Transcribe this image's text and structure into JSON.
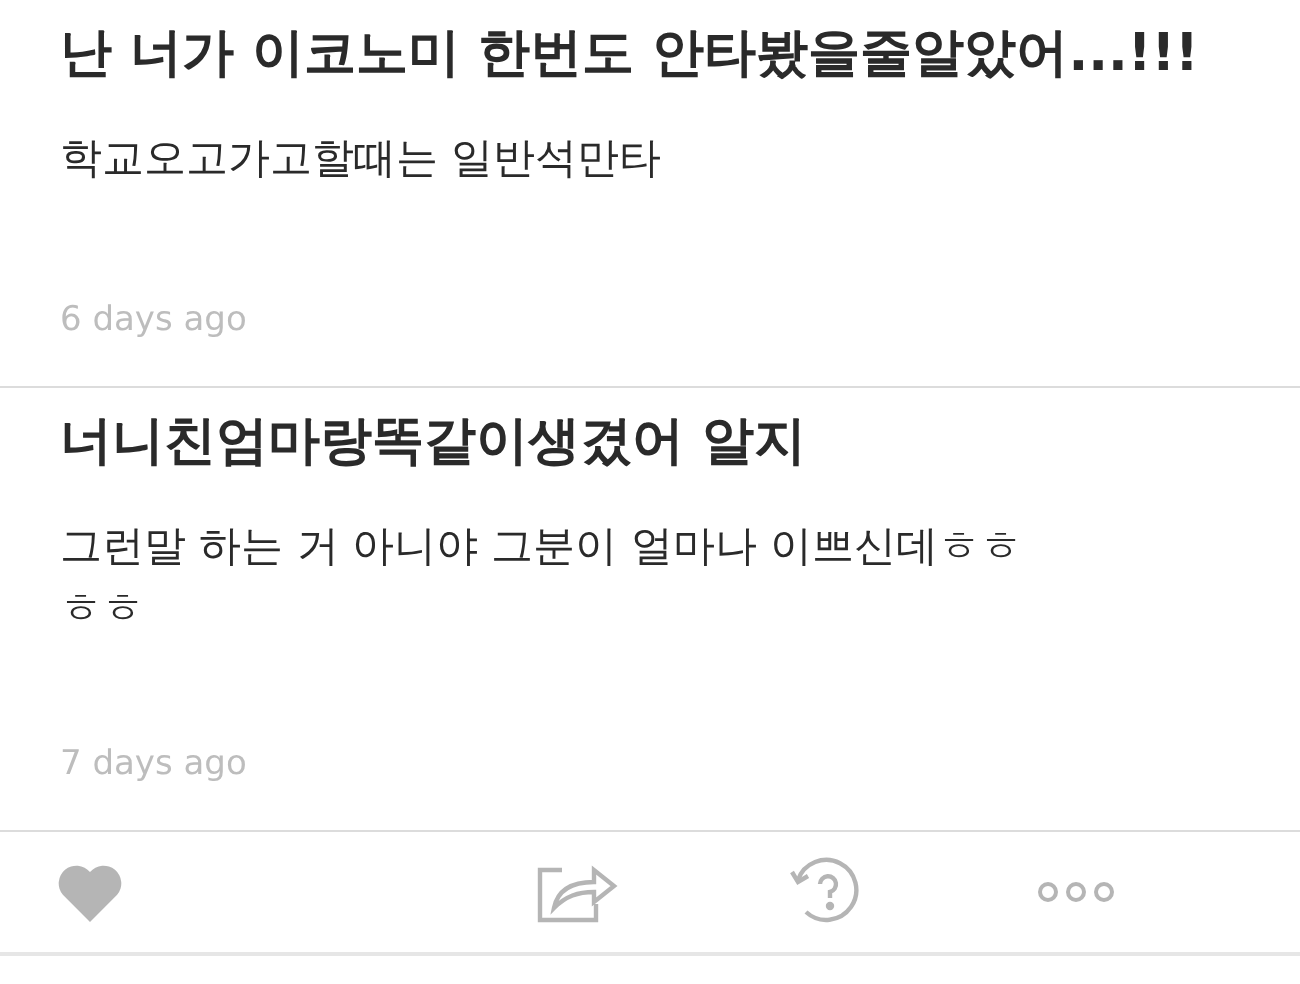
{
  "comments": [
    {
      "title": "난 너가 이코노미 한번도 안타봤을줄알았어...!!!",
      "body": "학교오고가고할때는 일반석만타",
      "time": "6 days ago"
    },
    {
      "title": "너니친엄마랑똑같이생겼어 알지",
      "body": "그런말 하는 거 아니야 그분이 얼마나 이쁘신데ㅎㅎㅎㅎ",
      "time": "7 days ago"
    }
  ],
  "actions": [
    {
      "kind": "like"
    },
    {
      "kind": "share"
    },
    {
      "kind": "help"
    },
    {
      "kind": "more"
    }
  ]
}
